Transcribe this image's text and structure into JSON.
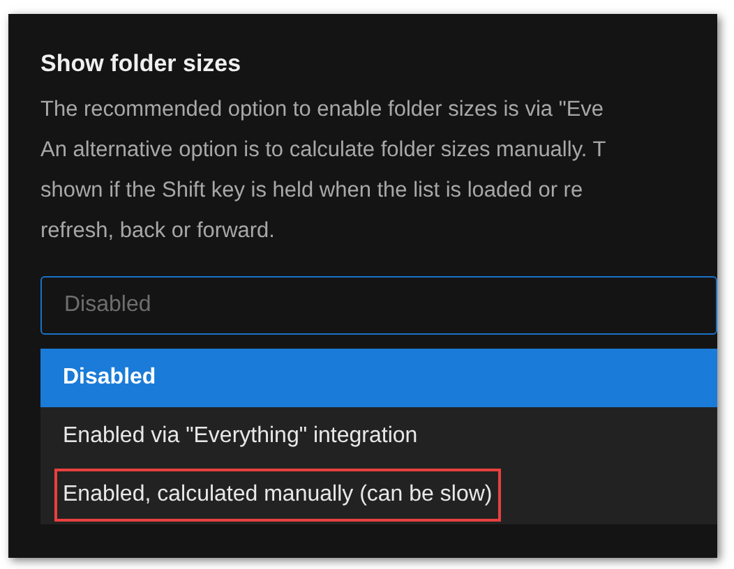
{
  "setting": {
    "title": "Show folder sizes",
    "description_lines": [
      "The recommended option to enable folder sizes is via \"Eve",
      "An alternative option is to calculate folder sizes manually. T",
      "shown if the Shift key is held when the list is loaded or re",
      "refresh, back or forward."
    ],
    "dropdown": {
      "placeholder": "Disabled",
      "options": [
        {
          "label": "Disabled",
          "selected": true,
          "outlined": false
        },
        {
          "label": "Enabled via \"Everything\" integration",
          "selected": false,
          "outlined": false
        },
        {
          "label": "Enabled, calculated manually (can be slow)",
          "selected": false,
          "outlined": true
        }
      ]
    }
  }
}
